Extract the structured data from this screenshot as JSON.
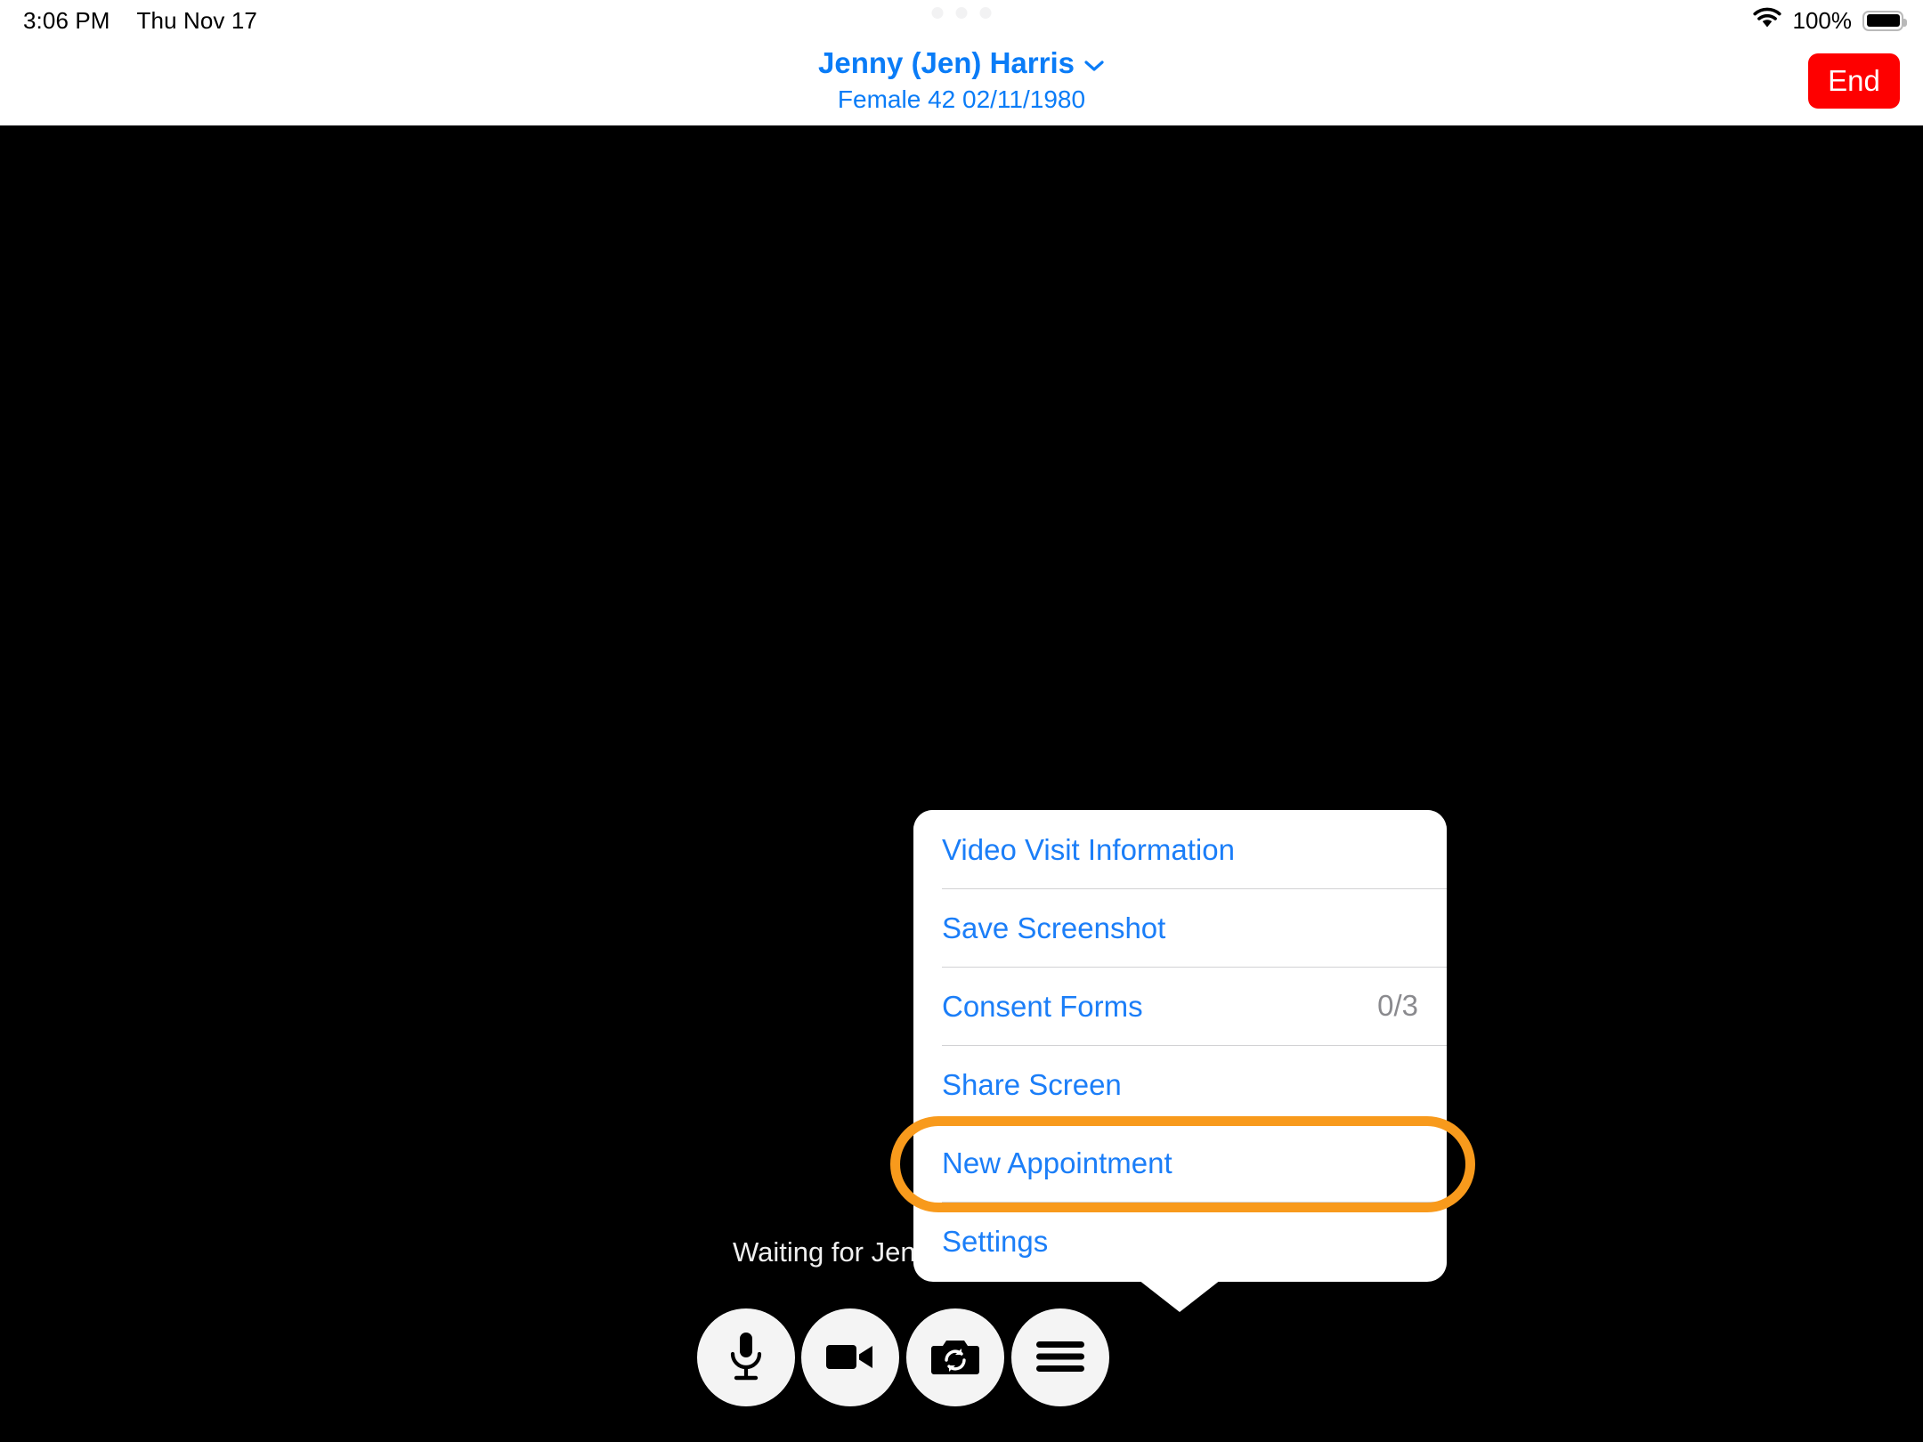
{
  "status_bar": {
    "time": "3:06 PM",
    "date": "Thu Nov 17",
    "battery_percent": "100%",
    "wifi_icon": "wifi-icon",
    "battery_icon": "battery-full-icon",
    "multitask_dots": "multitasking-handle"
  },
  "header": {
    "patient_name": "Jenny (Jen) Harris",
    "chevron": "⌄",
    "patient_details": "Female 42 02/11/1980",
    "end_call_label": "End",
    "name_color": "#0a7cf7",
    "end_button_color": "#fe0000"
  },
  "video": {
    "waiting_message": "Waiting for Jenny (Jen) Harris to join...",
    "background_color": "#000000"
  },
  "popover_menu": {
    "items": [
      {
        "label": "Video Visit Information",
        "badge": "",
        "name": "video-visit-information"
      },
      {
        "label": "Save Screenshot",
        "badge": "",
        "name": "save-screenshot"
      },
      {
        "label": "Consent Forms",
        "badge": "0/3",
        "name": "consent-forms"
      },
      {
        "label": "Share Screen",
        "badge": "",
        "name": "share-screen"
      },
      {
        "label": "New Appointment",
        "badge": "",
        "name": "new-appointment"
      },
      {
        "label": "Settings",
        "badge": "",
        "name": "settings"
      }
    ],
    "link_color": "#1b7ef8",
    "badge_color": "#8a8a8e"
  },
  "annotation": {
    "highlighted_item": "New Appointment",
    "color": "#f89a1c"
  },
  "controls": [
    {
      "name": "microphone-button",
      "icon": "microphone-icon"
    },
    {
      "name": "video-camera-button",
      "icon": "video-camera-icon"
    },
    {
      "name": "flip-camera-button",
      "icon": "camera-flip-icon"
    },
    {
      "name": "more-menu-button",
      "icon": "hamburger-menu-icon"
    }
  ]
}
